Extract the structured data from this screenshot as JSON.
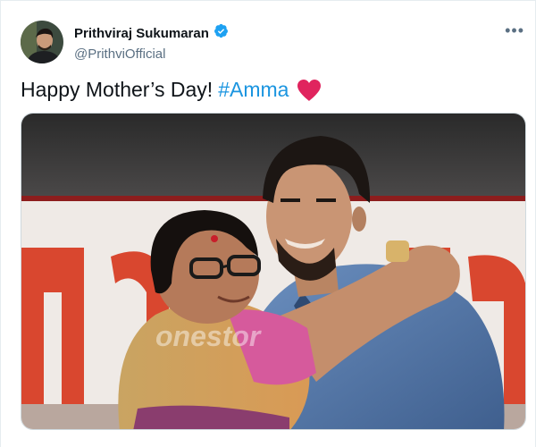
{
  "tweet": {
    "display_name": "Prithviraj Sukumaran",
    "handle": "@PrithviOfficial",
    "text": "Happy Mother’s Day!",
    "hashtag": "#Amma",
    "more_label": "•••"
  },
  "colors": {
    "link": "#1b95e0",
    "verified": "#1da1f2",
    "heart": "#e0245e",
    "secondary_text": "#5b7083"
  },
  "icons": {
    "verified": "verified-badge-icon",
    "more": "more-options-icon",
    "heart": "heart-emoji-icon"
  }
}
